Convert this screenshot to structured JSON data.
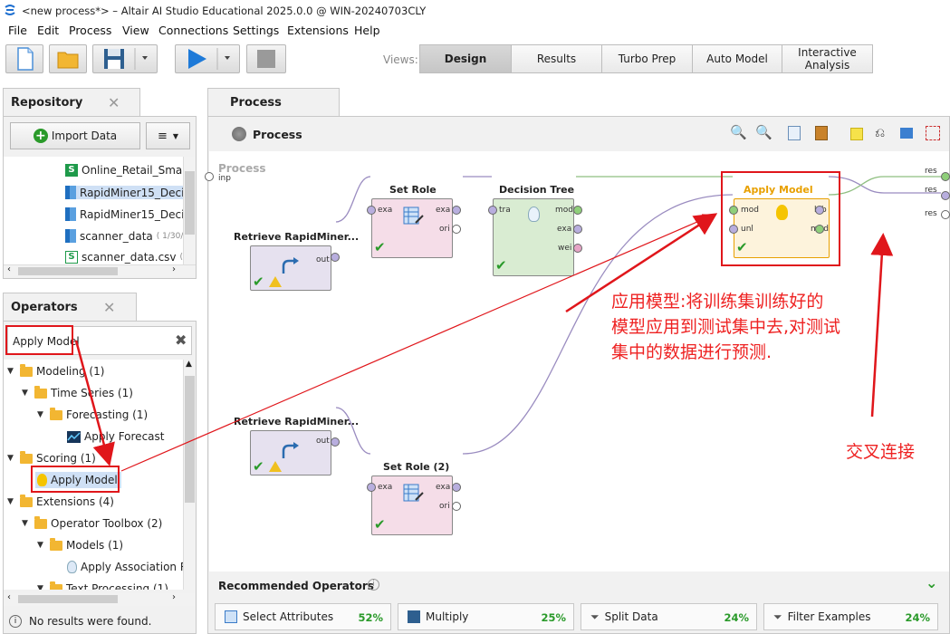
{
  "window": {
    "title": "<new process*> – Altair AI Studio Educational 2025.0.0 @ WIN-20240703CLY"
  },
  "menu": [
    "File",
    "Edit",
    "Process",
    "View",
    "Connections",
    "Settings",
    "Extensions",
    "Help"
  ],
  "views": {
    "label": "Views:",
    "buttons": [
      "Design",
      "Results",
      "Turbo Prep",
      "Auto Model",
      "Interactive Analysis"
    ],
    "active": "Design"
  },
  "repository": {
    "tab": "Repository",
    "import_label": "Import Data",
    "items": [
      "Online_Retail_Sma",
      "RapidMiner15_Deci",
      "RapidMiner15_Deci",
      "scanner_data",
      "scanner_data.csv"
    ],
    "item_meta": [
      "",
      "",
      "",
      "( 1/30/",
      "( "
    ]
  },
  "operators": {
    "tab": "Operators",
    "search_value": "Apply Model",
    "tree": [
      "Modeling (1)",
      "Time Series (1)",
      "Forecasting (1)",
      "Apply Forecast",
      "Scoring (1)",
      "Apply Model",
      "Extensions (4)",
      "Operator Toolbox (2)",
      "Models (1)",
      "Apply Association R",
      "Text Processing (1)"
    ],
    "status": "No results were found."
  },
  "process": {
    "tab": "Process",
    "header": "Process",
    "canvas_label": "Process",
    "nodes": {
      "retrieve1": "Retrieve RapidMiner...",
      "retrieve2": "Retrieve RapidMiner...",
      "setrole": "Set Role",
      "setrole2": "Set Role (2)",
      "dtree": "Decision Tree",
      "apply": "Apply Model"
    },
    "ports": {
      "inp": "inp",
      "out": "out",
      "exa": "exa",
      "ori": "ori",
      "tra": "tra",
      "mod": "mod",
      "wei": "wei",
      "unl": "unl",
      "lab": "lab",
      "res": "res"
    }
  },
  "annotations": {
    "apply_note": [
      "应用模型:将训练集训练好的",
      "模型应用到测试集中去,对测试",
      "集中的数据进行预测."
    ],
    "cross_note": "交叉连接"
  },
  "recommended": {
    "title": "Recommended Operators",
    "items": [
      {
        "label": "Select Attributes",
        "pct": "52%"
      },
      {
        "label": "Multiply",
        "pct": "25%"
      },
      {
        "label": "Split Data",
        "pct": "24%"
      },
      {
        "label": "Filter Examples",
        "pct": "24%"
      }
    ]
  },
  "colors": {
    "annotation": "#e0161b",
    "accent_green": "#2a9a2a",
    "apply_title": "#e8a000"
  }
}
